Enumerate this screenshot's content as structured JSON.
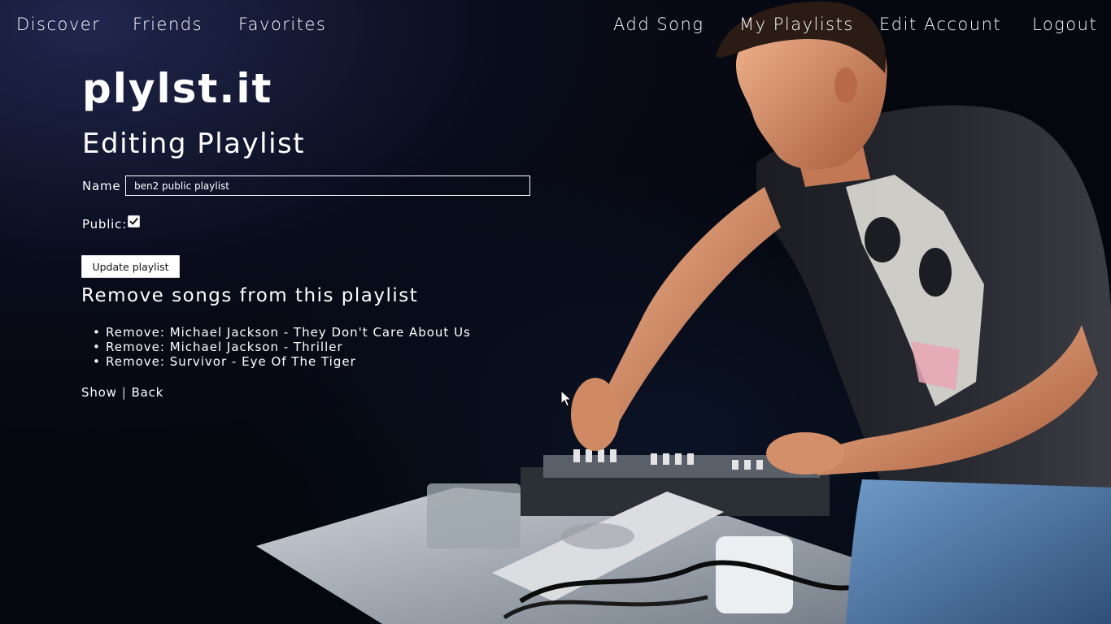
{
  "nav": {
    "left": [
      {
        "label": "Discover"
      },
      {
        "label": "Friends"
      },
      {
        "label": "Favorites"
      }
    ],
    "right": [
      {
        "label": "Add Song"
      },
      {
        "label": "My Playlists"
      },
      {
        "label": "Edit Account"
      },
      {
        "label": "Logout"
      }
    ]
  },
  "brand": "plylst.it",
  "page_title": "Editing Playlist",
  "form": {
    "name_label": "Name",
    "name_value": "ben2 public playlist",
    "public_label": "Public:",
    "public_checked": true,
    "submit_label": "Update playlist"
  },
  "remove_section": {
    "heading": "Remove songs from this playlist",
    "items": [
      {
        "label": "Remove: Michael Jackson - They Don't Care About Us"
      },
      {
        "label": "Remove: Michael Jackson - Thriller"
      },
      {
        "label": "Remove: Survivor - Eye Of The Tiger"
      }
    ]
  },
  "footer": {
    "show_label": "Show",
    "separator": "|",
    "back_label": "Back"
  },
  "colors": {
    "background": "#05070e",
    "text": "#ffffff",
    "button_bg": "#ffffff",
    "button_text": "#111111"
  }
}
